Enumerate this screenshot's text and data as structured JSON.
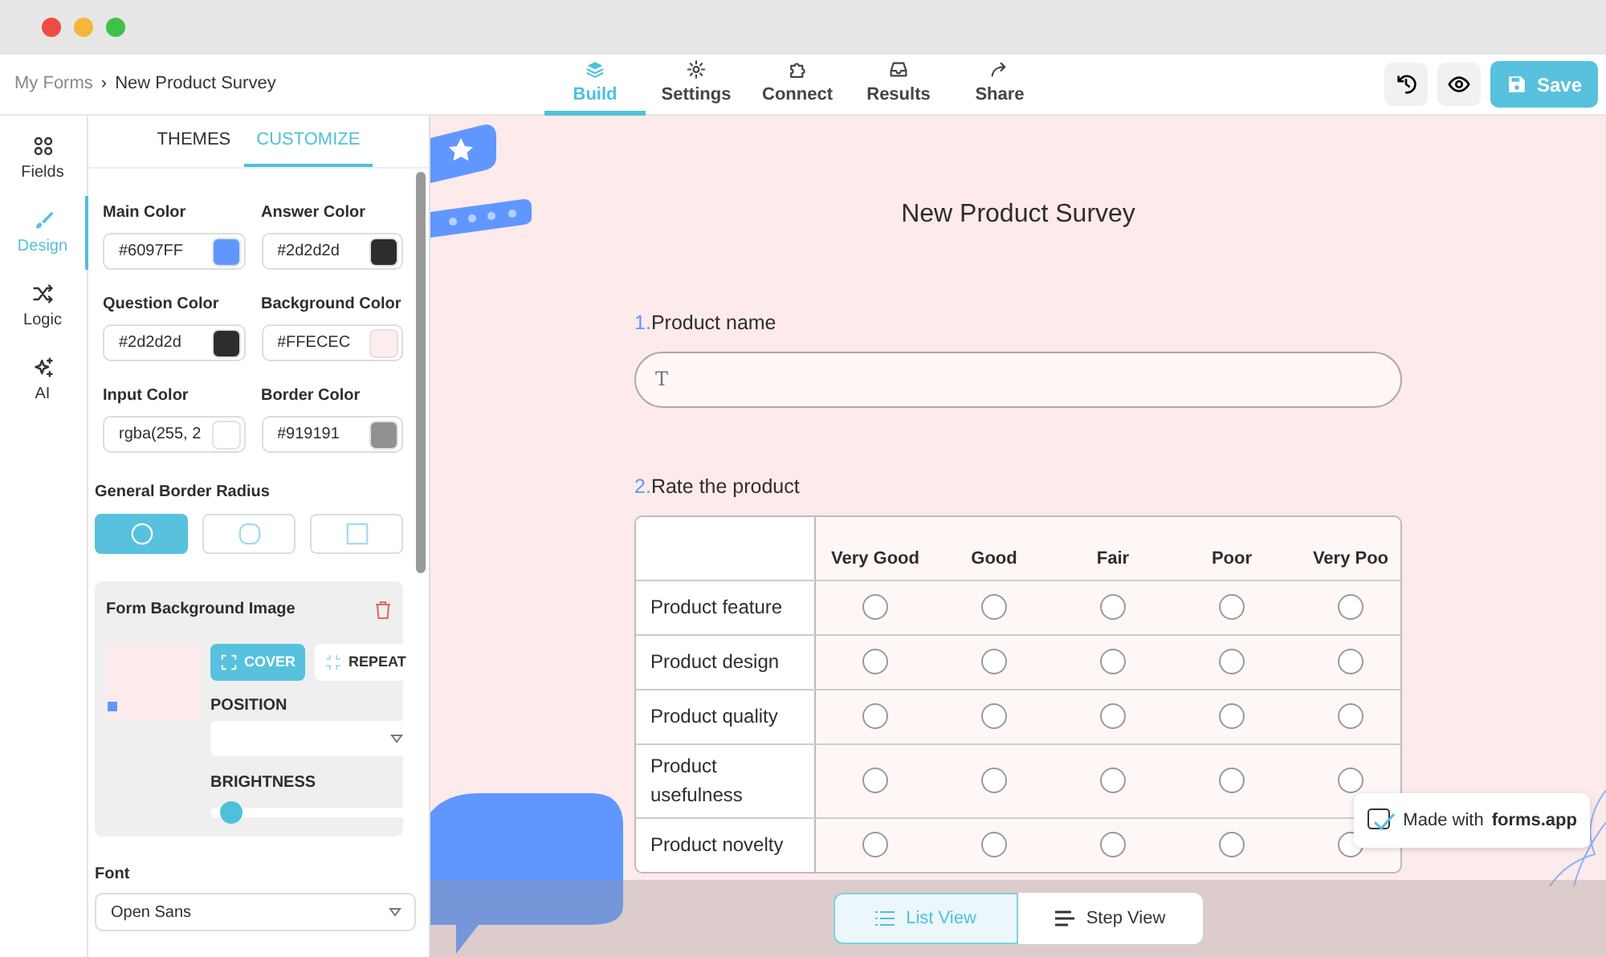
{
  "breadcrumb": {
    "items": [
      "My Forms",
      "New Product Survey"
    ],
    "separator": "›"
  },
  "nav_tabs": [
    {
      "label": "Build",
      "selected": true
    },
    {
      "label": "Settings",
      "selected": false
    },
    {
      "label": "Connect",
      "selected": false
    },
    {
      "label": "Results",
      "selected": false
    },
    {
      "label": "Share",
      "selected": false
    }
  ],
  "save_button": "Save",
  "rail": [
    {
      "label": "Fields",
      "selected": false
    },
    {
      "label": "Design",
      "selected": true
    },
    {
      "label": "Logic",
      "selected": false
    },
    {
      "label": "AI",
      "selected": false
    }
  ],
  "panel_tabs": [
    {
      "label": "THEMES",
      "selected": false
    },
    {
      "label": "CUSTOMIZE",
      "selected": true
    }
  ],
  "colors": [
    {
      "label": "Main Color",
      "value": "#6097FF",
      "color": "#6097ff"
    },
    {
      "label": "Answer Color",
      "value": "#2d2d2d",
      "color": "#2d2d2d"
    },
    {
      "label": "Question Color",
      "value": "#2d2d2d",
      "color": "#2d2d2d"
    },
    {
      "label": "Background Color",
      "value": "#FFECEC",
      "color": "#ffecec"
    },
    {
      "label": "Input Color",
      "value": "rgba(255, 2",
      "color": "#ffffff"
    },
    {
      "label": "Border Color",
      "value": "#919191",
      "color": "#919191"
    }
  ],
  "border_radius": {
    "label": "General Border Radius",
    "options": [
      {
        "selected": true
      },
      {
        "selected": false
      },
      {
        "selected": false
      }
    ]
  },
  "background_image": {
    "title": "Form Background Image",
    "modes": [
      {
        "label": "COVER",
        "selected": true
      },
      {
        "label": "REPEAT",
        "selected": false
      }
    ],
    "position_label": "POSITION",
    "brightness_label": "BRIGHTNESS",
    "brightness": {
      "level": 0.05
    }
  },
  "font": {
    "label": "Font",
    "value": "Open Sans"
  },
  "form": {
    "title": "New Product Survey",
    "questions": [
      {
        "kind": "text",
        "number": "1.",
        "label": "Product name",
        "placeholder": "T"
      },
      {
        "kind": "matrix",
        "number": "2.",
        "label": "Rate the product",
        "columns": [
          "Very Good",
          "Good",
          "Fair",
          "Poor",
          "Very Poo"
        ],
        "rows": [
          {
            "label": "Product feature",
            "checked": [
              false,
              false,
              false,
              false,
              false
            ]
          },
          {
            "label": "Product design",
            "checked": [
              false,
              false,
              false,
              false,
              false
            ]
          },
          {
            "label": "Product quality",
            "checked": [
              false,
              false,
              false,
              false,
              false
            ]
          },
          {
            "label": "Product usefulness",
            "checked": [
              false,
              false,
              false,
              false,
              false
            ]
          },
          {
            "label": "Product novelty",
            "checked": [
              false,
              false,
              false,
              false,
              false
            ]
          }
        ]
      }
    ]
  },
  "badge": {
    "prefix": "Made with",
    "brand": "forms.app"
  },
  "view_toggle": [
    {
      "label": "List View",
      "selected": true
    },
    {
      "label": "Step View",
      "selected": false
    }
  ]
}
